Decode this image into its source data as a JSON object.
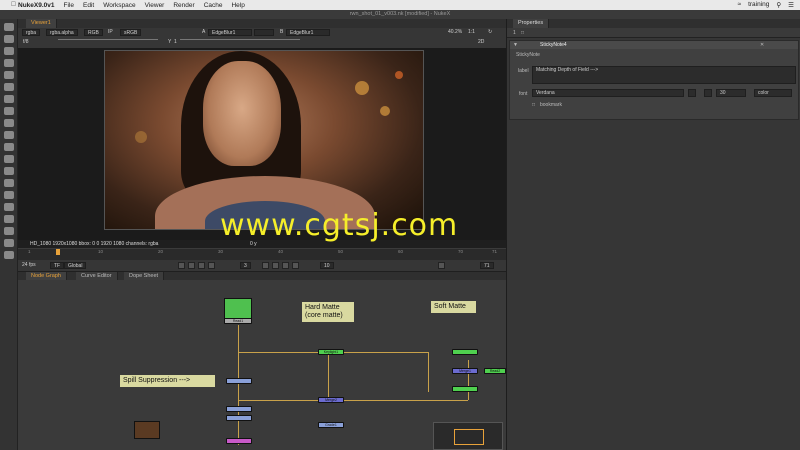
{
  "menubar": {
    "apple_icon": "apple-icon",
    "app": "NukeX9.0v1",
    "items": [
      "File",
      "Edit",
      "Workspace",
      "Viewer",
      "Render",
      "Cache",
      "Help"
    ],
    "user": "training"
  },
  "window_title": "rwn_shot_01_v003.nk [modified] - NukeX",
  "viewer": {
    "tab": "Viewer1",
    "channels": "rgba",
    "alpha": "rgba.alpha",
    "colorspace_label": "RGB",
    "ip": "IP",
    "lut": "sRGB",
    "a_input": "EdgeBlur1",
    "b_input": "EdgeBlur1",
    "a_label": "A",
    "b_label": "B",
    "zoom": "40.2%",
    "ratio": "1:1",
    "frame_counter": "f/8",
    "y_label": "Y",
    "y_value": "1",
    "view_mode": "2D",
    "info": "HD_1080 1920x1080  bbox: 0 0 1920 1080 channels: rgba",
    "info_right": "0 y"
  },
  "timeline": {
    "start": "1",
    "end": "71",
    "labels": [
      "10",
      "20",
      "30",
      "40",
      "50",
      "60",
      "70"
    ],
    "fps": "24 fps",
    "tf": "TF",
    "global": "Global",
    "current_frame": "3",
    "step": "10",
    "end_frame": "71"
  },
  "panels": {
    "tabs": [
      "Node Graph",
      "Curve Editor",
      "Dope Sheet"
    ]
  },
  "nodegraph": {
    "sticky_notes": [
      {
        "text": "Hard Matte\n(core matte)"
      },
      {
        "text": "Soft Matte"
      },
      {
        "text": "Spill Suppression --->"
      }
    ],
    "read_node_label": "Read1",
    "read_node_label2": "Read2",
    "node_labels": [
      "Keylight1",
      "Merge1",
      "Grade1",
      "Merge2"
    ]
  },
  "properties": {
    "tab": "Properties",
    "node_count": "1",
    "node_name": "StickyNote4",
    "section": "StickyNote",
    "label_field_label": "label",
    "label_value": "Matching Depth of Field --->",
    "font_label": "font",
    "font_value": "Verdana",
    "font_size": "30",
    "color_label": "color",
    "bookmark_label": "bookmark"
  },
  "watermark": "www.cgtsj.com"
}
